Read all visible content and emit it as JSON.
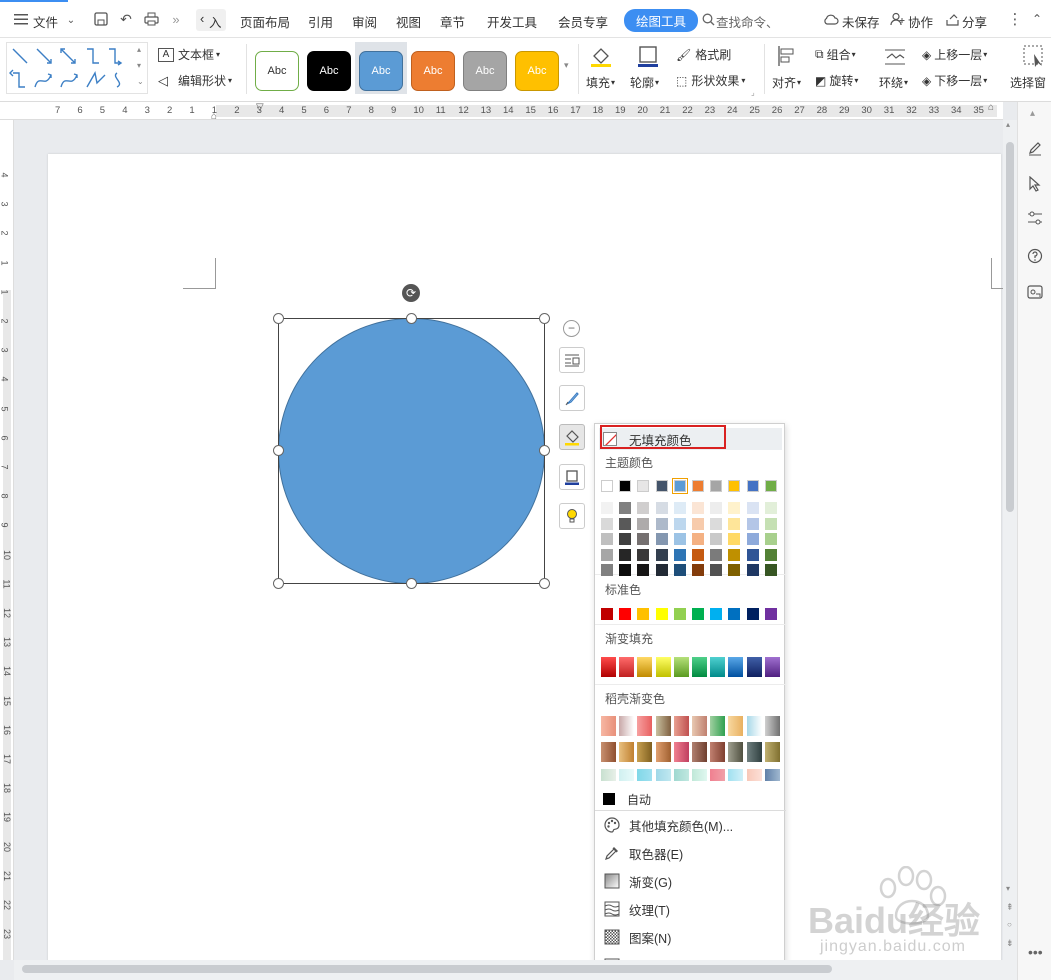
{
  "menubar": {
    "file": "文件",
    "tabs": [
      "入",
      "页面布局",
      "引用",
      "审阅",
      "视图",
      "章节",
      "开发工具",
      "会员专享",
      "绘图工具"
    ],
    "active_tab": "绘图工具",
    "search": "查找命令、",
    "unsaved": "未保存",
    "collab": "协作",
    "share": "分享"
  },
  "ribbon": {
    "textbox": "文本框",
    "edit_shape": "编辑形状",
    "style_label": "Abc",
    "fill": "填充",
    "outline": "轮廓",
    "format_brush": "格式刷",
    "shape_effect": "形状效果",
    "align": "对齐",
    "group": "组合",
    "rotate": "旋转",
    "wrap": "环绕",
    "bring_forward": "上移一层",
    "send_backward": "下移一层",
    "select_pane": "选择窗"
  },
  "ruler": {
    "h_ticks": [
      "7",
      "6",
      "5",
      "4",
      "3",
      "2",
      "1",
      "1",
      "2",
      "3",
      "4",
      "5",
      "6",
      "7",
      "8",
      "9",
      "10",
      "11",
      "12",
      "13",
      "14",
      "15",
      "16",
      "17",
      "18",
      "19",
      "20",
      "21",
      "22",
      "23",
      "24",
      "25",
      "26",
      "27",
      "28",
      "29",
      "30",
      "31",
      "32",
      "33",
      "34",
      "35"
    ],
    "v_ticks": [
      "4",
      "3",
      "2",
      "1",
      "1",
      "2",
      "3",
      "4",
      "5",
      "6",
      "7",
      "8",
      "9",
      "10",
      "11",
      "12",
      "13",
      "14",
      "15",
      "16",
      "17",
      "18",
      "19",
      "20",
      "21",
      "22",
      "23"
    ]
  },
  "shape": {
    "fill_color": "#5b9bd5",
    "outline_color": "#41719c"
  },
  "dropdown": {
    "no_fill": "无填充颜色",
    "theme_colors": "主题颜色",
    "standard_colors": "标准色",
    "gradient_fill": "渐变填充",
    "docer_gradient": "稻壳渐变色",
    "auto": "自动",
    "items": [
      "其他填充颜色(M)...",
      "取色器(E)",
      "渐变(G)",
      "纹理(T)",
      "图案(N)",
      "图片(P)"
    ],
    "theme_top": [
      "#ffffff",
      "#000000",
      "#e7e6e6",
      "#44546a",
      "#5b9bd5",
      "#ed7d31",
      "#a5a5a5",
      "#ffc000",
      "#4472c4",
      "#70ad47"
    ],
    "standard": [
      "#c00000",
      "#ff0000",
      "#ffc000",
      "#ffff00",
      "#92d050",
      "#00b050",
      "#00b0f0",
      "#0070c0",
      "#002060",
      "#7030a0"
    ]
  },
  "watermark": {
    "brand": "Baidu经验",
    "url": "jingyan.baidu.com"
  }
}
